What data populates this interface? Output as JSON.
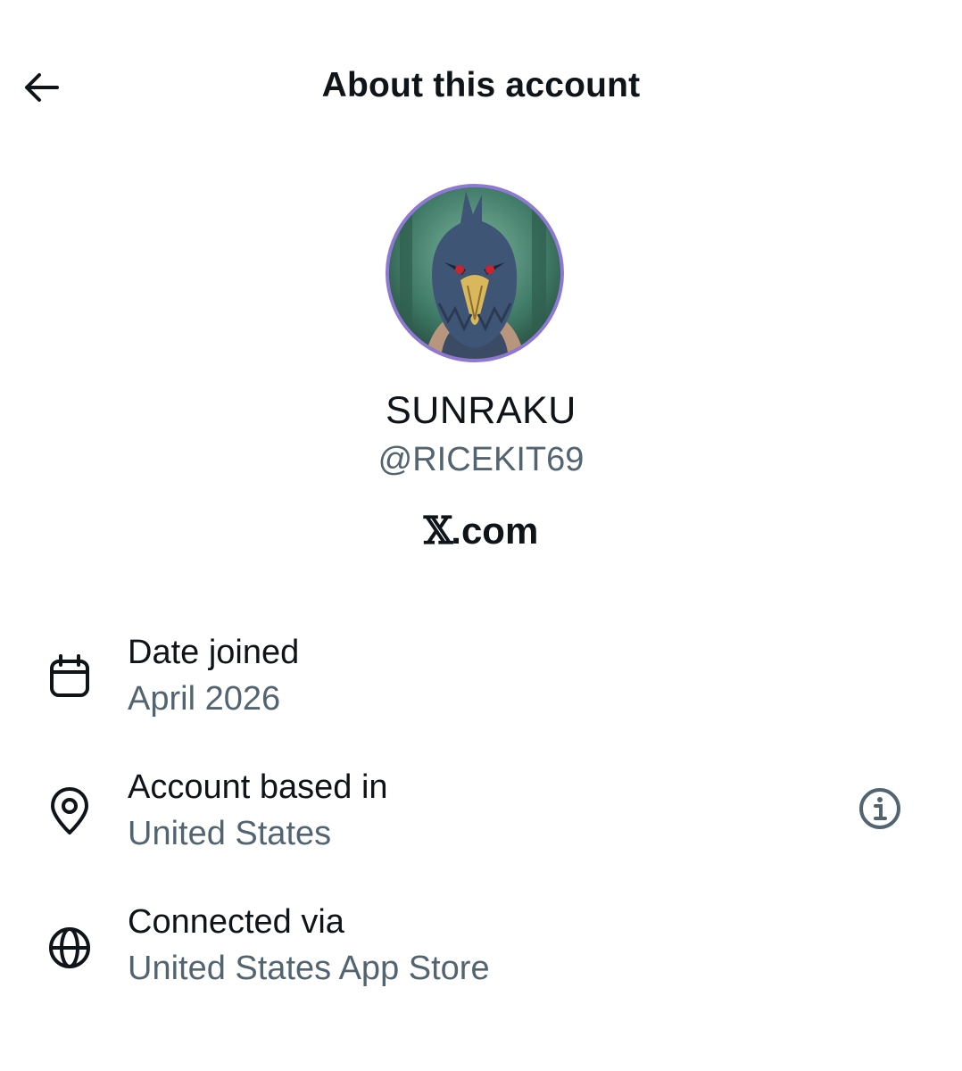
{
  "header": {
    "title": "About this account",
    "back_icon": "arrow-left-icon"
  },
  "profile": {
    "display_name": "SUNRAKU",
    "handle": "@RICEKIT69",
    "platform_mark": "𝕏",
    "platform_suffix": ".com",
    "avatar_border_color": "#8f78d4"
  },
  "details": [
    {
      "icon": "calendar-icon",
      "label": "Date joined",
      "value": "April 2026"
    },
    {
      "icon": "location-pin-icon",
      "label": "Account based in",
      "value": "United States",
      "action_icon": "info-icon"
    },
    {
      "icon": "globe-icon",
      "label": "Connected via",
      "value": "United States App Store"
    }
  ],
  "colors": {
    "primary_text": "#0f1419",
    "secondary_text": "#536471",
    "background": "#ffffff"
  }
}
